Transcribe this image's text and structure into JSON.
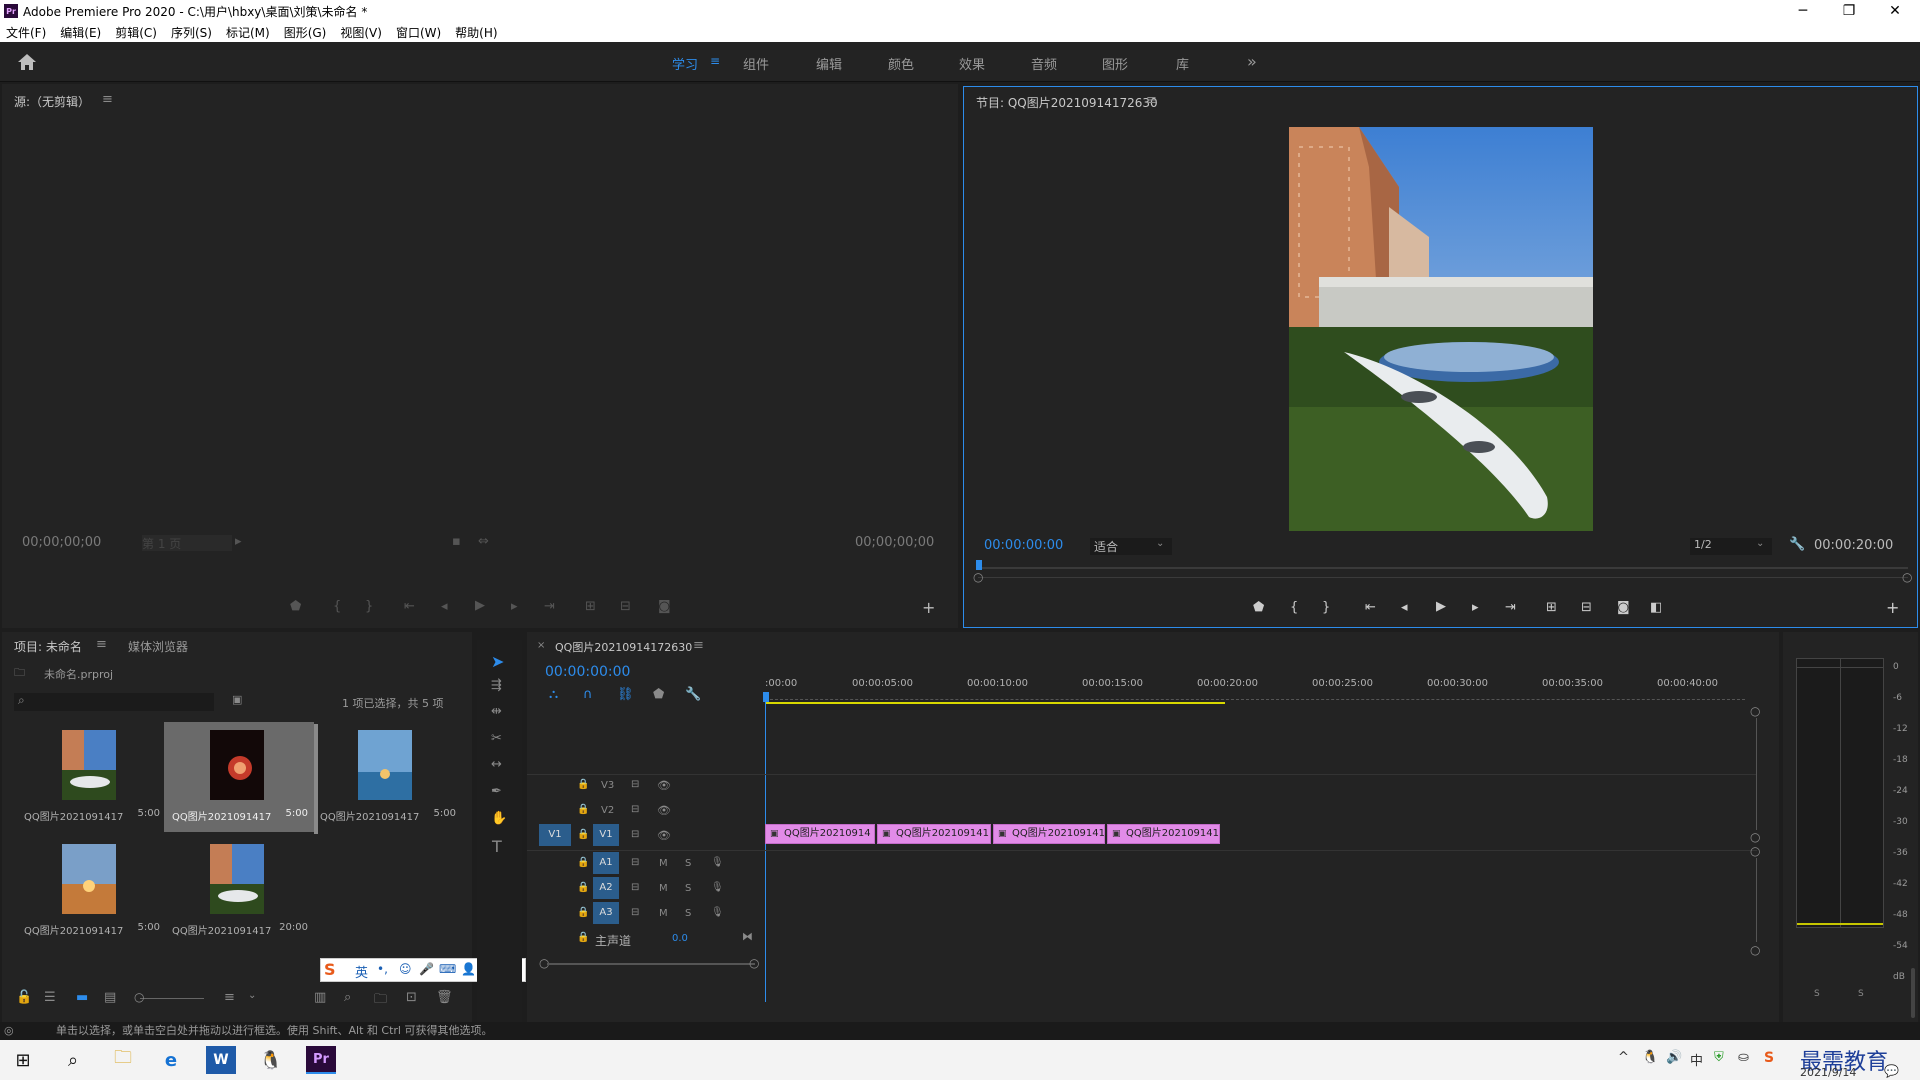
{
  "window": {
    "title": "Adobe Premiere Pro 2020 - C:\\用户\\hbxy\\桌面\\刘策\\未命名 *",
    "logo": "Pr"
  },
  "menu": [
    "文件(F)",
    "编辑(E)",
    "剪辑(C)",
    "序列(S)",
    "标记(M)",
    "图形(G)",
    "视图(V)",
    "窗口(W)",
    "帮助(H)"
  ],
  "workspaces": {
    "items": [
      "学习",
      "组件",
      "编辑",
      "颜色",
      "效果",
      "音频",
      "图形",
      "库"
    ],
    "active": "学习",
    "more": "»"
  },
  "source": {
    "title": "源:（无剪辑）",
    "tc_left": "00;00;00;00",
    "page": "第 1 页",
    "tc_right": "00;00;00;00"
  },
  "program": {
    "title": "节目: QQ图片20210914172630",
    "tc_current": "00:00:00:00",
    "fit": "适合",
    "quality": "1/2",
    "tc_duration": "00:00:20:00"
  },
  "project": {
    "tab1": "项目: 未命名",
    "tab2": "媒体浏览器",
    "file": "未命名.prproj",
    "selection_info": "1 项已选择，共 5 项",
    "items": [
      {
        "name": "QQ图片20210914172...",
        "dur": "5:00"
      },
      {
        "name": "QQ图片20210914172...",
        "dur": "5:00"
      },
      {
        "name": "QQ图片20210914172...",
        "dur": "5:00"
      },
      {
        "name": "QQ图片20210914172...",
        "dur": "5:00"
      },
      {
        "name": "QQ图片2021091417...",
        "dur": "20:00"
      }
    ]
  },
  "timeline": {
    "tab": "QQ图片20210914172630",
    "tc": "00:00:00:00",
    "ruler": [
      ":00:00",
      "00:00:05:00",
      "00:00:10:00",
      "00:00:15:00",
      "00:00:20:00",
      "00:00:25:00",
      "00:00:30:00",
      "00:00:35:00",
      "00:00:40:00"
    ],
    "video_tracks": [
      "V3",
      "V2",
      "V1"
    ],
    "audio_tracks": [
      "A1",
      "A2",
      "A3"
    ],
    "source_patch": "V1",
    "master_label": "主声道",
    "master_value": "0.0",
    "clips": [
      "QQ图片20210914",
      "QQ图片202109141",
      "QQ图片202109141",
      "QQ图片202109141"
    ],
    "mute": "M",
    "solo": "S"
  },
  "meter": {
    "scale": [
      "0",
      "-6",
      "-12",
      "-18",
      "-24",
      "-30",
      "-36",
      "-42",
      "-48",
      "-54",
      "dB"
    ],
    "solo_left": "S",
    "solo_right": "S"
  },
  "ime": {
    "lang": "英"
  },
  "status": {
    "text": "单击以选择，或单击空白处并拖动以进行框选。使用 Shift、Alt 和 Ctrl 可获得其他选项。"
  },
  "taskbar": {
    "clock": "2021/9/14",
    "watermark": "最需教育"
  }
}
